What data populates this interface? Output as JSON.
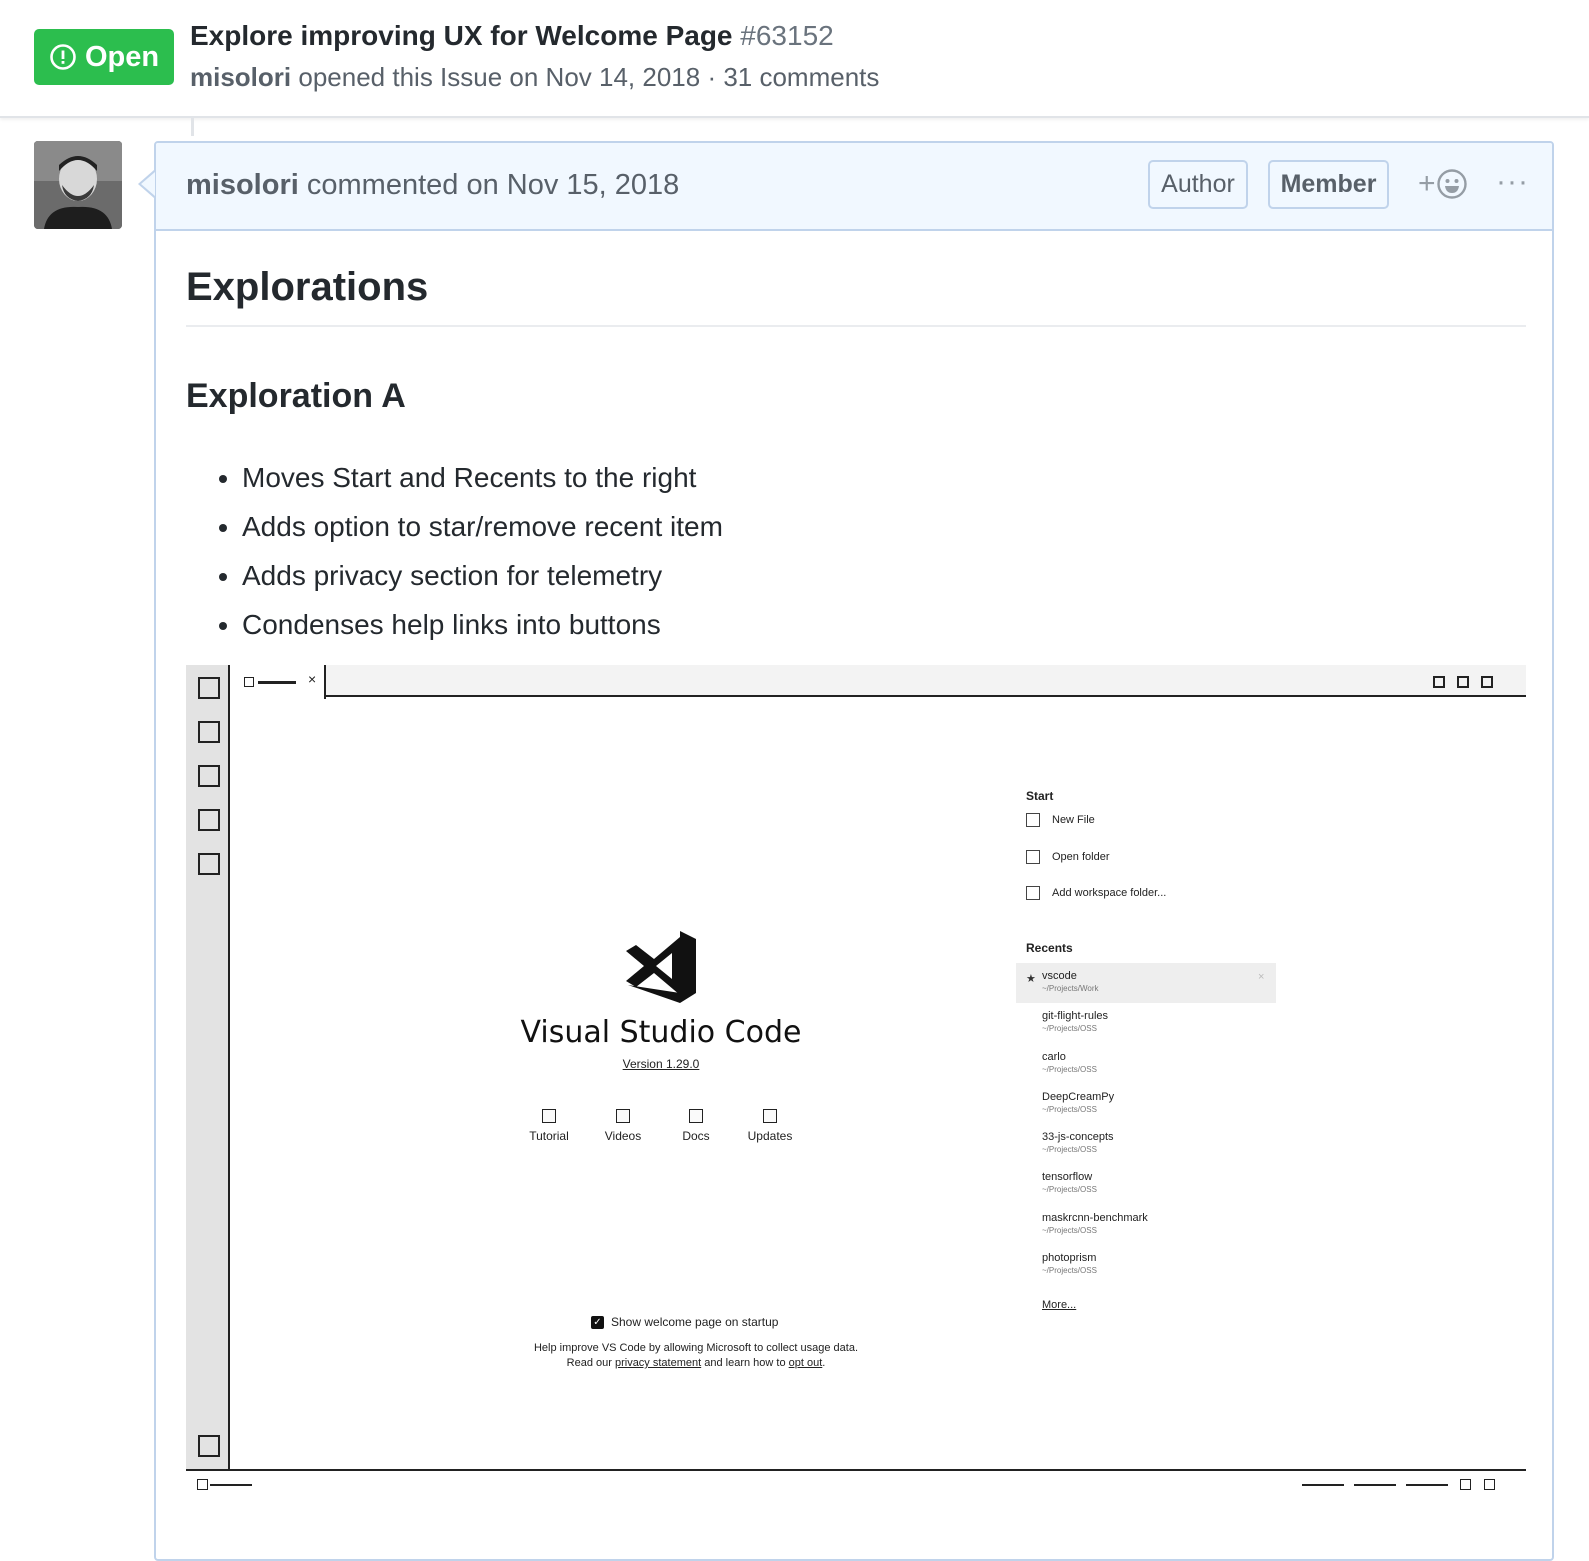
{
  "issue": {
    "state_label": "Open",
    "title": "Explore improving UX for Welcome Page",
    "number": "#63152",
    "author": "misolori",
    "meta_text": "opened this Issue on Nov 14, 2018 · 31 comments",
    "state_color": "#2cbe4e"
  },
  "comment": {
    "author": "misolori",
    "action_text": "commented on Nov 15, 2018",
    "label_author": "Author",
    "label_member": "Member",
    "reaction_plus": "+",
    "more": "···",
    "h1": "Explorations",
    "h2": "Exploration A",
    "bullets": [
      "Moves Start and Recents to the right",
      "Adds option to star/remove recent item",
      "Adds privacy section for telemetry",
      "Condenses help links into buttons"
    ]
  },
  "mockup": {
    "tab_close": "×",
    "app_name": "Visual Studio Code",
    "version": "Version 1.29.0",
    "help_links": [
      "Tutorial",
      "Videos",
      "Docs",
      "Updates"
    ],
    "show_welcome": "Show welcome page on startup",
    "privacy_line1": "Help improve VS Code by allowing Microsoft to collect usage data.",
    "privacy_read": "Read our",
    "privacy_link": "privacy statement",
    "privacy_mid": "and learn how to",
    "privacy_opt": "opt out",
    "privacy_end": ".",
    "start_heading": "Start",
    "start_items": [
      "New File",
      "Open folder",
      "Add workspace folder..."
    ],
    "recents_heading": "Recents",
    "recents": [
      {
        "name": "vscode",
        "path": "~/Projects/Work"
      },
      {
        "name": "git-flight-rules",
        "path": "~/Projects/OSS"
      },
      {
        "name": "carlo",
        "path": "~/Projects/OSS"
      },
      {
        "name": "DeepCreamPy",
        "path": "~/Projects/OSS"
      },
      {
        "name": "33-js-concepts",
        "path": "~/Projects/OSS"
      },
      {
        "name": "tensorflow",
        "path": "~/Projects/OSS"
      },
      {
        "name": "maskrcnn-benchmark",
        "path": "~/Projects/OSS"
      },
      {
        "name": "photoprism",
        "path": "~/Projects/OSS"
      }
    ],
    "recent_star": "★",
    "recent_remove": "×",
    "more_link": "More..."
  }
}
